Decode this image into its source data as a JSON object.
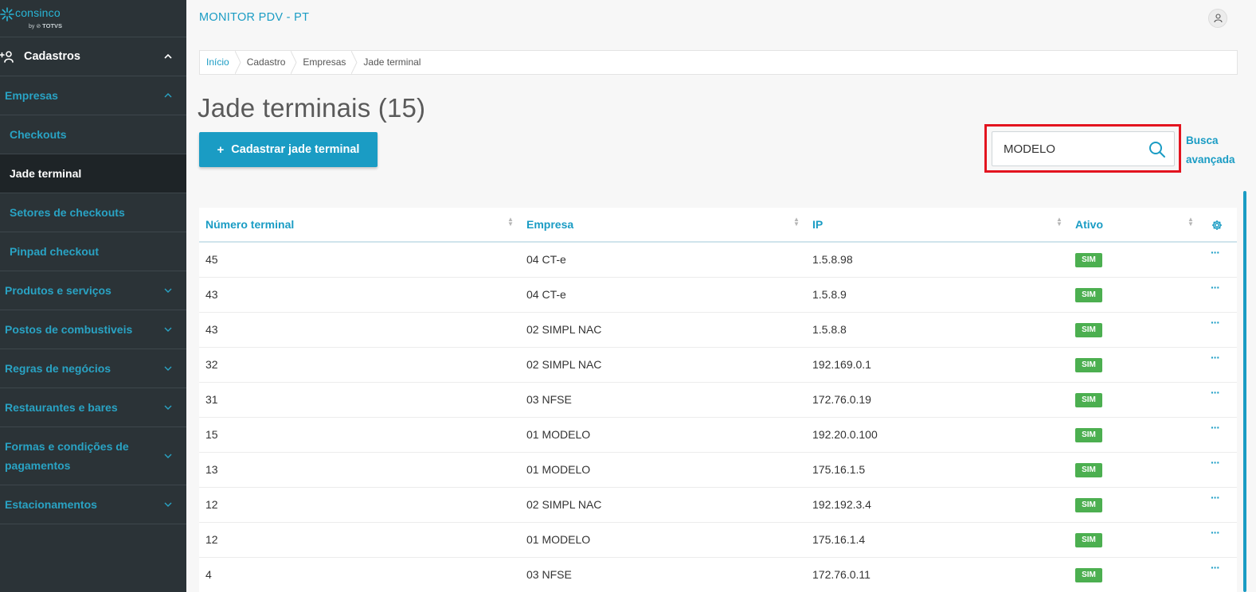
{
  "brand": {
    "name": "consinco",
    "by": "by",
    "parent": "TOTVS"
  },
  "app_title": "MONITOR PDV - PT",
  "sidebar": {
    "header": "Cadastros",
    "items": [
      {
        "label": "Empresas"
      },
      {
        "label": "Checkouts"
      },
      {
        "label": "Jade terminal"
      },
      {
        "label": "Setores de checkouts"
      },
      {
        "label": "Pinpad checkout"
      },
      {
        "label": "Produtos e serviços"
      },
      {
        "label": "Postos de combustiveis"
      },
      {
        "label": "Regras de negócios"
      },
      {
        "label": "Restaurantes e bares"
      },
      {
        "label": "Formas e condições de pagamentos"
      },
      {
        "label": "Estacionamentos"
      }
    ]
  },
  "breadcrumb": [
    "Início",
    "Cadastro",
    "Empresas",
    "Jade terminal"
  ],
  "page_title": "Jade terminais (15)",
  "add_button": {
    "label": "Cadastrar jade terminal",
    "icon": "+"
  },
  "search": {
    "value": "MODELO",
    "advanced_label_1": "Busca",
    "advanced_label_2": "avançada"
  },
  "table": {
    "columns": [
      "Número terminal",
      "Empresa",
      "IP",
      "Ativo"
    ],
    "rows": [
      {
        "num": "45",
        "empresa": "04 CT-e",
        "ip": "1.5.8.98",
        "ativo": "SIM"
      },
      {
        "num": "43",
        "empresa": "04 CT-e",
        "ip": "1.5.8.9",
        "ativo": "SIM"
      },
      {
        "num": "43",
        "empresa": "02 SIMPL NAC",
        "ip": "1.5.8.8",
        "ativo": "SIM"
      },
      {
        "num": "32",
        "empresa": "02 SIMPL NAC",
        "ip": "192.169.0.1",
        "ativo": "SIM"
      },
      {
        "num": "31",
        "empresa": "03 NFSE",
        "ip": "172.76.0.19",
        "ativo": "SIM"
      },
      {
        "num": "15",
        "empresa": "01 MODELO",
        "ip": "192.20.0.100",
        "ativo": "SIM"
      },
      {
        "num": "13",
        "empresa": "01 MODELO",
        "ip": "175.16.1.5",
        "ativo": "SIM"
      },
      {
        "num": "12",
        "empresa": "02 SIMPL NAC",
        "ip": "192.192.3.4",
        "ativo": "SIM"
      },
      {
        "num": "12",
        "empresa": "01 MODELO",
        "ip": "175.16.1.4",
        "ativo": "SIM"
      },
      {
        "num": "4",
        "empresa": "03 NFSE",
        "ip": "172.76.0.11",
        "ativo": "SIM"
      }
    ],
    "row_menu": "···"
  },
  "colors": {
    "accent": "#1a9cc4",
    "sidebar": "#2b3337",
    "active": "#1e2427",
    "success": "#4caf50",
    "highlight": "#e3141f"
  }
}
